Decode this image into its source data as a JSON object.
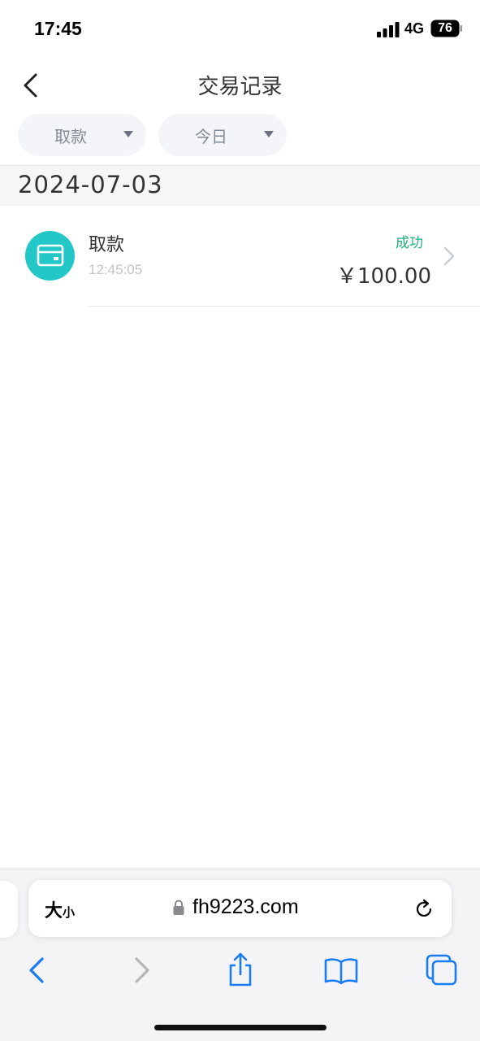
{
  "status_bar": {
    "time": "17:45",
    "network": "4G",
    "battery": "76"
  },
  "header": {
    "title": "交易记录",
    "back_icon": "chevron-left-icon"
  },
  "filters": {
    "type": {
      "label": "取款"
    },
    "date": {
      "label": "今日"
    }
  },
  "records": {
    "date": "2024-07-03",
    "items": [
      {
        "type": "取款",
        "time": "12:45:05",
        "status": "成功",
        "amount": "￥100.00",
        "icon": "card-icon"
      }
    ]
  },
  "colors": {
    "accent": "#23c7c7",
    "success": "#22b07d",
    "safari_blue": "#1a7cf2"
  },
  "browser": {
    "text_size_big": "大",
    "text_size_small": "小",
    "url": "fh9223.com"
  }
}
